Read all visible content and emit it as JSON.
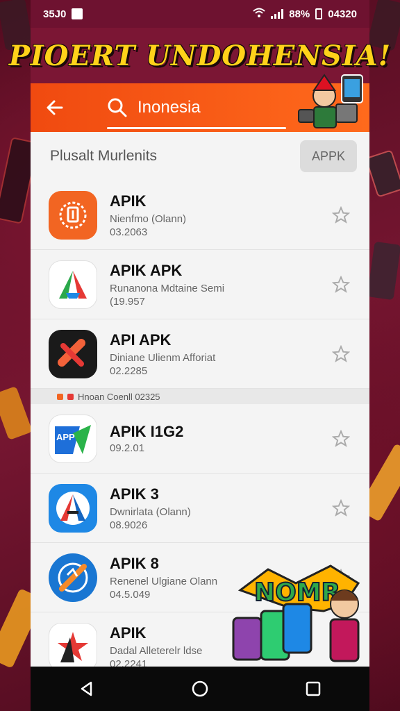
{
  "status_bar": {
    "left_time": "35J0",
    "right_battery": "88%",
    "right_time": "04320"
  },
  "banner": {
    "title": "PIOERT UNDOHENSIA!"
  },
  "search": {
    "query": "Inonesia"
  },
  "section": {
    "title": "Plusalt Murlenits",
    "apk_button": "APPK"
  },
  "apps": [
    {
      "name": "APIK",
      "sub": "Nienfmo (Olann)",
      "date": "03.2063",
      "icon": "orange-lock-icon"
    },
    {
      "name": "APIK APK",
      "sub": "Runanona Mdtaine Semi",
      "date": "(19.957",
      "icon": "triangle-a-icon"
    },
    {
      "name": "API APK",
      "sub": "Diniane Ulienm Afforiat",
      "date": "02.2285",
      "icon": "cross-x-icon"
    },
    {
      "name": "APIK I1G2",
      "sub": "",
      "date": "09.2.01",
      "icon": "app-arrow-icon"
    },
    {
      "name": "APIK 3",
      "sub": "Dwnirlata (Olann)",
      "date": "08.9026",
      "icon": "blue-a-icon"
    },
    {
      "name": "APIK 8",
      "sub": "Renenel Ulgiane Olann",
      "date": "04.5.049",
      "icon": "compass-icon"
    },
    {
      "name": "APIK",
      "sub": "Dadal Alleterelr ldse",
      "date": "02.2241",
      "icon": "ar-star-icon"
    }
  ],
  "divider": {
    "label": "Hnoan Coenll 02325"
  },
  "sticker": {
    "text": "NOMR"
  },
  "colors": {
    "header_orange": "#f04a10",
    "banner_yellow": "#ffd21a",
    "background": "#5a0c22",
    "card": "#f4f4f4"
  }
}
